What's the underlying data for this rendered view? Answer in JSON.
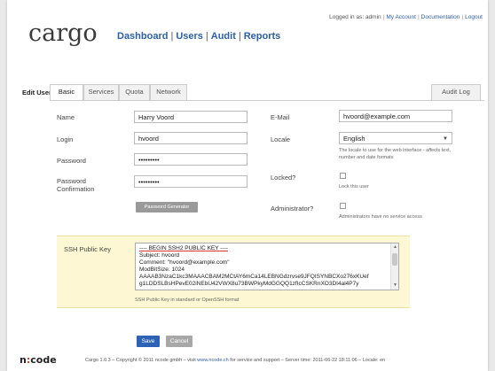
{
  "app": {
    "logo": "cargo"
  },
  "topbar": {
    "logged_in": "Logged in as: admin",
    "links": [
      "My Account",
      "Documentation",
      "Logout"
    ]
  },
  "nav": {
    "items": [
      "Dashboard",
      "Users",
      "Audit",
      "Reports"
    ]
  },
  "page": {
    "title": "Edit User Harry Voord"
  },
  "tabs": [
    "Basic",
    "Services",
    "Quota",
    "Network"
  ],
  "tab_right": "Audit Log",
  "form": {
    "name_label": "Name",
    "name_value": "Harry Voord",
    "login_label": "Login",
    "login_value": "hvoord",
    "password_label": "Password",
    "password_value": "•••••••••",
    "password_confirm_label_1": "Password",
    "password_confirm_label_2": "Confirmation",
    "password_confirm_value": "•••••••••",
    "password_generator_button": "Password Generator",
    "email_label": "E-Mail",
    "email_value": "hvoord@example.com",
    "locale_label": "Locale",
    "locale_value": "English",
    "locale_hint_1": "The locale to use for the web interface - affects text,",
    "locale_hint_2": "number and date formats",
    "locked_label": "Locked?",
    "locked_hint": "Lock this user",
    "admin_label": "Administrator?",
    "admin_hint": "Administrators have no service access",
    "ssh_label": "SSH Public Key",
    "ssh_lines": [
      "---- BEGIN SSH2 PUBLIC KEY ----",
      "Subject: hvoord",
      "Comment: \"hvoord@example.com\"",
      "ModBitSize: 1024",
      "AAAAB3NzaC1kc3MAAACBAM2MCtAY6mCa14LEBNGdzrvse9JFQISYNBCXo276xKUef",
      "g1LDDSLBsHPevE02iNEbU42VWX8u73BWPkyMdGGQQ1zfIcCSKRnXO3DI4al4P7y"
    ],
    "ssh_hint": "SSH Public Key in standard or OpenSSH format"
  },
  "buttons": {
    "save": "Save",
    "cancel": "Cancel"
  },
  "footer": {
    "logo_n": "n",
    "logo_colon": ":",
    "logo_rest": "code",
    "text_before": "Cargo 1.0.3 – Copyright © 2011 ncode gmbh – visit ",
    "link": "www.ncode.ch",
    "text_after": " for service and support – Server time: 2011-06-22 18:11:06 – Locale: en"
  }
}
